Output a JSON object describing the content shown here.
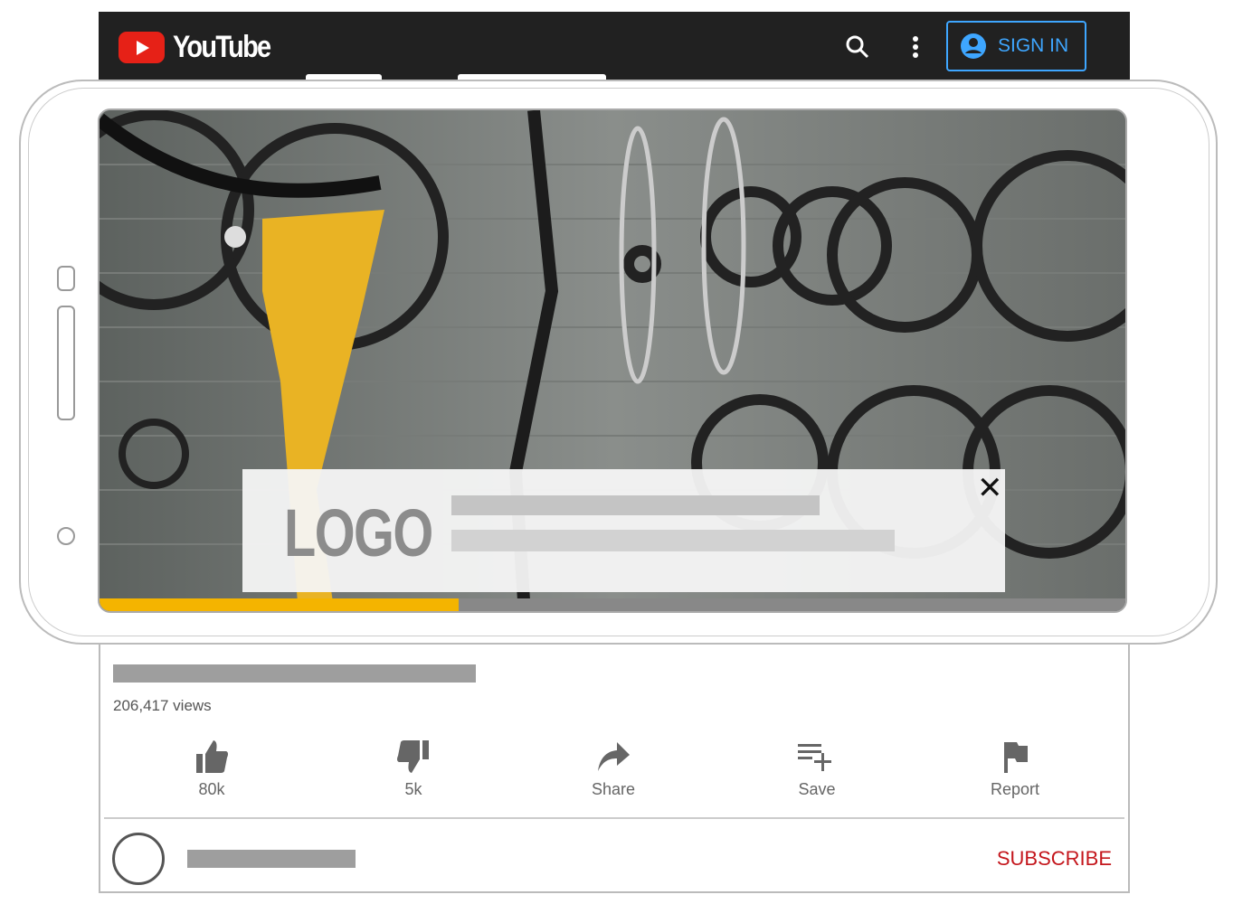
{
  "header": {
    "brand": "YouTube",
    "sign_in": "SIGN IN"
  },
  "ad": {
    "logo": "LOGO",
    "close": "✕"
  },
  "player": {
    "progress_percent": 35
  },
  "video": {
    "views": "206,417 views"
  },
  "actions": [
    {
      "label": "80k"
    },
    {
      "label": "5k"
    },
    {
      "label": "Share"
    },
    {
      "label": "Save"
    },
    {
      "label": "Report"
    }
  ],
  "channel": {
    "subscribe": "SUBSCRIBE"
  },
  "colors": {
    "accent": "#3ea6ff",
    "brand": "#e62117",
    "subscribe": "#c4161c",
    "progress": "#f4b400"
  }
}
